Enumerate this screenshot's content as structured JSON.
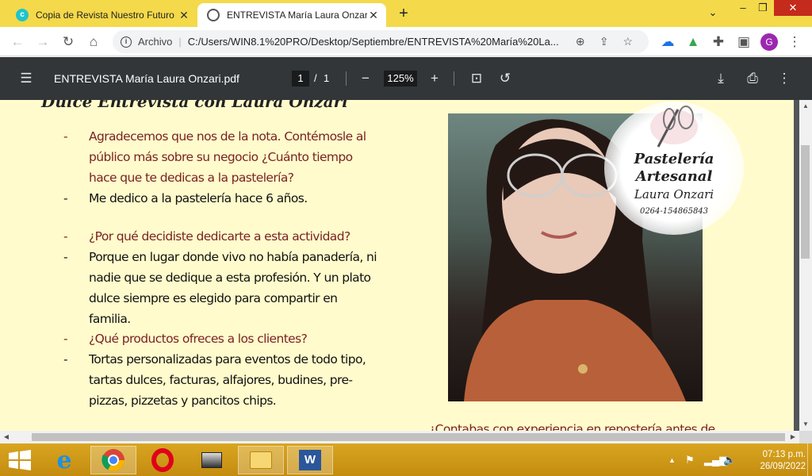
{
  "browser": {
    "tabs": [
      {
        "title": "Copia de Revista Nuestro Futuro",
        "active": false,
        "icon": "canva-icon"
      },
      {
        "title": "ENTREVISTA María Laura Onzari.p",
        "active": true,
        "icon": "globe-icon"
      }
    ],
    "new_tab": "+",
    "window_controls": {
      "chevron": "⌄",
      "minimize": "–",
      "restore": "❐",
      "close": "✕"
    },
    "address": {
      "scheme_label": "Archivo",
      "url": "C:/Users/WIN8.1%20PRO/Desktop/Septiembre/ENTREVISTA%20María%20La..."
    },
    "profile_initial": "G",
    "accent_color": "#f4d94a"
  },
  "pdf_toolbar": {
    "file_name": "ENTREVISTA María Laura Onzari.pdf",
    "current_page": "1",
    "page_separator": "/",
    "total_pages": "1",
    "zoom": "125%"
  },
  "document": {
    "heading": "Dulce Entrevista con Laura Onzari",
    "qa": [
      {
        "type": "q",
        "text": "Agradecemos que nos de la nota. Contémosle al público más sobre su negocio ¿Cuánto tiempo hace que te dedicas a la pastelería?"
      },
      {
        "type": "a",
        "text": "Me dedico a la pastelería hace 6 años."
      },
      {
        "type": "q",
        "text": "¿Por qué decidiste dedicarte a esta actividad?"
      },
      {
        "type": "a",
        "text": "Porque en lugar donde vivo no había panadería, ni nadie que se dedique a esta profesión. Y un plato dulce siempre es elegido para compartir en familia."
      },
      {
        "type": "q",
        "text": "¿Qué productos ofreces a los clientes?"
      },
      {
        "type": "a",
        "text": "Tortas personalizadas para eventos de todo tipo, tartas dulces, facturas, alfajores, budines, pre-pizzas, pizzetas y pancitos chips."
      }
    ],
    "dash": "-",
    "logo": {
      "line1": "Pastelería",
      "line2": "Artesanal",
      "line3": "Laura Onzari",
      "phone": "0264-154865843"
    },
    "bottom_question": "¿Contabas con experiencia en repostería antes de"
  },
  "taskbar": {
    "time": "07:13 p.m.",
    "date": "26/09/2022"
  }
}
